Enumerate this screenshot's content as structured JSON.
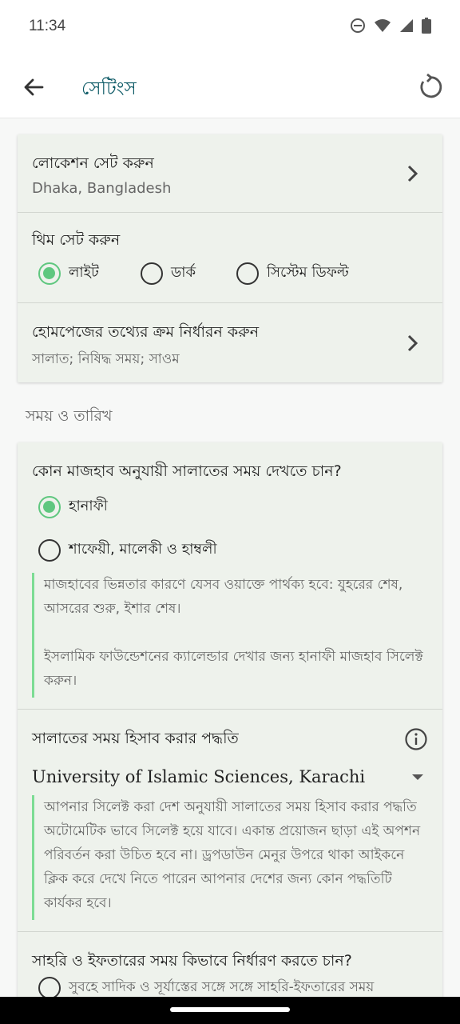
{
  "status": {
    "time": "11:34",
    "icons": [
      "do-not-disturb-icon",
      "wifi-icon",
      "signal-icon",
      "battery-icon"
    ]
  },
  "app_bar": {
    "title": "সেটিংস",
    "back_icon": "arrow-left-icon",
    "reset_icon": "reset-icon"
  },
  "general": {
    "location": {
      "title": "লোকেশন সেট করুন",
      "value": "Dhaka, Bangladesh"
    },
    "theme": {
      "title": "থিম সেট করুন",
      "options": [
        "লাইট",
        "ডার্ক",
        "সিস্টেম ডিফল্ট"
      ],
      "selected": "লাইট"
    },
    "homepage_order": {
      "title": "হোমপেজের তথ্যের ক্রম নির্ধারন করুন",
      "value": "সালাত; নিষিদ্ধ সময়; সাওম"
    }
  },
  "time_date": {
    "section_label": "সময় ও তারিখ",
    "madhab": {
      "title": "কোন মাজহাব অনুযায়ী সালাতের সময় দেখতে চান?",
      "options": [
        "হানাফী",
        "শাফেয়ী, মালেকী ও হাম্বলী"
      ],
      "selected": "হানাফী",
      "note_1": "মাজহাবের ভিন্নতার কারণে যেসব ওয়াক্তে পার্থক্য হবে: যুহরের শেষ, আসরের শুরু, ইশার শেষ।",
      "note_2": "ইসলামিক ফাউন্ডেশনের ক্যালেন্ডার দেখার জন্য হানাফী মাজহাব সিলেক্ট করুন।"
    },
    "calc_method": {
      "title": "সালাতের সময় হিসাব করার পদ্ধতি",
      "info_icon": "info-icon",
      "selected": "University of Islamic Sciences, Karachi",
      "note": "আপনার সিলেক্ট করা দেশ অনুযায়ী সালাতের সময় হিসাব করার পদ্ধতি অটোমেটিক ভাবে সিলেক্ট হয়ে যাবে। একান্ত প্রয়োজন ছাড়া এই অপশন পরিবর্তন করা উচিত হবে না। ড্রপডাউন মেনুর উপরে থাকা আইকনে ক্লিক করে দেখে নিতে পারেন আপনার দেশের জন্য কোন পদ্ধতিটি কার্যকর হবে।"
    },
    "sehri_iftar": {
      "title": "সাহরি ও ইফতারের সময় কিভাবে নির্ধারণ করতে চান?",
      "option_1": "সুবহে সাদিক ও সূর্যাস্তের সঙ্গে সঙ্গে সাহরি-ইফতারের সময়"
    }
  },
  "colors": {
    "accent": "#5fc77f",
    "title": "#0d5a66",
    "card_bg": "#eef2ec"
  }
}
